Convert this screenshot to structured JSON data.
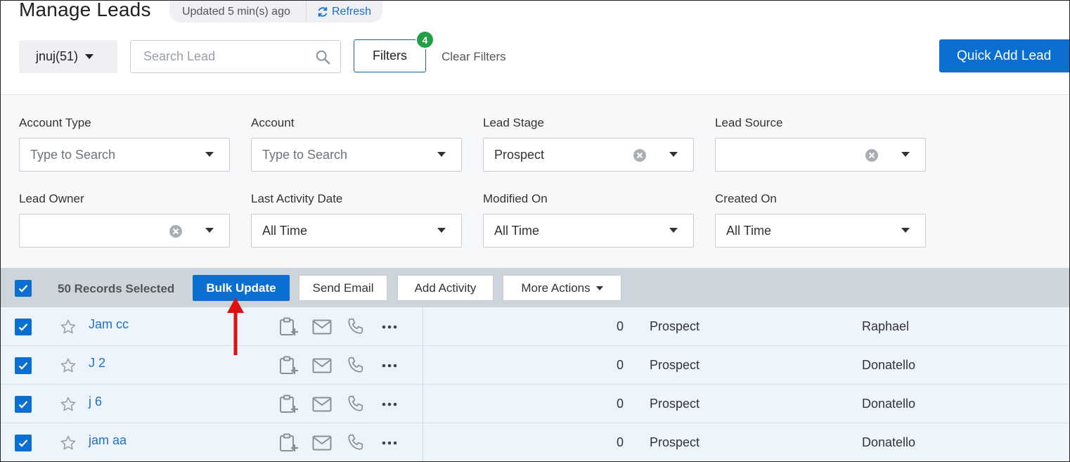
{
  "header": {
    "title": "Manage Leads",
    "updated": "Updated 5 min(s) ago",
    "refresh_label": "Refresh"
  },
  "toolbar": {
    "owner_filter": "jnuj(51)",
    "search_placeholder": "Search Lead",
    "filters_label": "Filters",
    "filters_count": "4",
    "clear_filters": "Clear Filters",
    "quick_add": "Quick Add Lead"
  },
  "filters": [
    {
      "label": "Account Type",
      "value": "",
      "placeholder": "Type to Search",
      "clearable": false
    },
    {
      "label": "Account",
      "value": "",
      "placeholder": "Type to Search",
      "clearable": false
    },
    {
      "label": "Lead Stage",
      "value": "Prospect",
      "placeholder": "",
      "clearable": true
    },
    {
      "label": "Lead Source",
      "value": "",
      "placeholder": "",
      "clearable": true
    },
    {
      "label": "Lead Owner",
      "value": "",
      "placeholder": "",
      "clearable": true
    },
    {
      "label": "Last Activity Date",
      "value": "All Time",
      "placeholder": "",
      "clearable": false
    },
    {
      "label": "Modified On",
      "value": "All Time",
      "placeholder": "",
      "clearable": false
    },
    {
      "label": "Created On",
      "value": "All Time",
      "placeholder": "",
      "clearable": false
    }
  ],
  "action_bar": {
    "records_selected": "50 Records Selected",
    "bulk_update": "Bulk Update",
    "send_email": "Send Email",
    "add_activity": "Add Activity",
    "more_actions": "More Actions"
  },
  "rows": [
    {
      "name": "Jam cc",
      "score": "0",
      "stage": "Prospect",
      "owner": "Raphael"
    },
    {
      "name": "J 2",
      "score": "0",
      "stage": "Prospect",
      "owner": "Donatello"
    },
    {
      "name": "j 6",
      "score": "0",
      "stage": "Prospect",
      "owner": "Donatello"
    },
    {
      "name": "jam aa",
      "score": "0",
      "stage": "Prospect",
      "owner": "Donatello"
    }
  ],
  "colors": {
    "primary": "#0b6fd1",
    "badge_green": "#23a047",
    "link_blue": "#1f6fc5",
    "annotation_red": "#e01010"
  }
}
